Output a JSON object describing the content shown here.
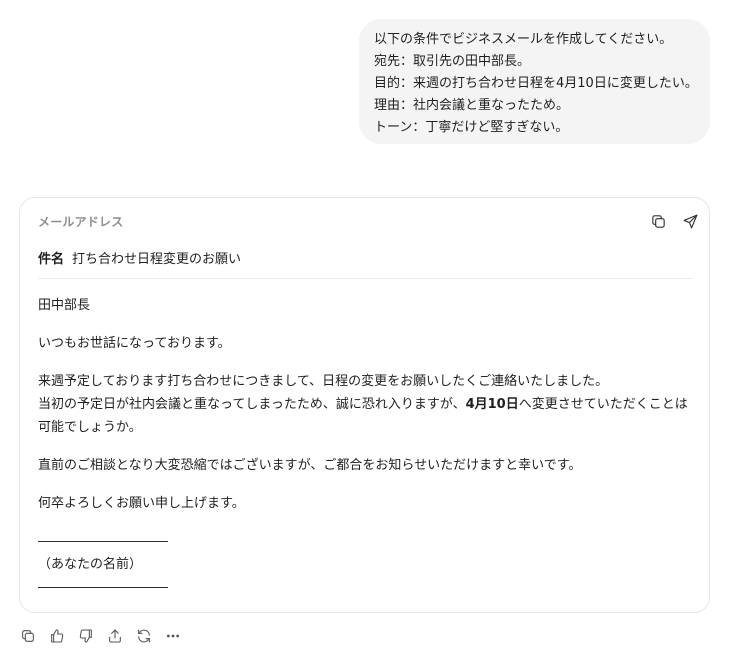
{
  "user_message": {
    "lines": [
      "以下の条件でビジネスメールを作成してください。",
      "宛先：取引先の田中部長。",
      "目的：来週の打ち合わせ日程を4月10日に変更したい。",
      "理由：社内会議と重なったため。",
      "トーン：丁寧だけど堅すぎない。"
    ]
  },
  "email_card": {
    "address_label": "メールアドレス",
    "subject_key": "件名",
    "subject_value": "打ち合わせ日程変更のお願い",
    "body": {
      "greeting": "田中部長",
      "opening": "いつもお世話になっております。",
      "para1_line1": "来週予定しております打ち合わせにつきまして、日程の変更をお願いしたくご連絡いたしました。",
      "para1_line2_pre": "当初の予定日が社内会議と重なってしまったため、誠に恐れ入りますが、",
      "para1_date": "4月10日",
      "para1_line2_post": "へ変更させていただくことは可能でしょうか。",
      "para2": "直前のご相談となり大変恐縮ではございますが、ご都合をお知らせいただけますと幸いです。",
      "closing": "何卒よろしくお願い申し上げます。",
      "sig_rule_top": "――――――――――",
      "sig_name": "（あなたの名前）",
      "sig_rule_bottom": "――――――――――"
    }
  },
  "icons": {
    "card_copy": "copy-icon",
    "card_send": "send-icon",
    "footer": [
      "copy-icon",
      "thumbs-up-icon",
      "thumbs-down-icon",
      "share-icon",
      "regenerate-icon",
      "more-icon"
    ]
  }
}
